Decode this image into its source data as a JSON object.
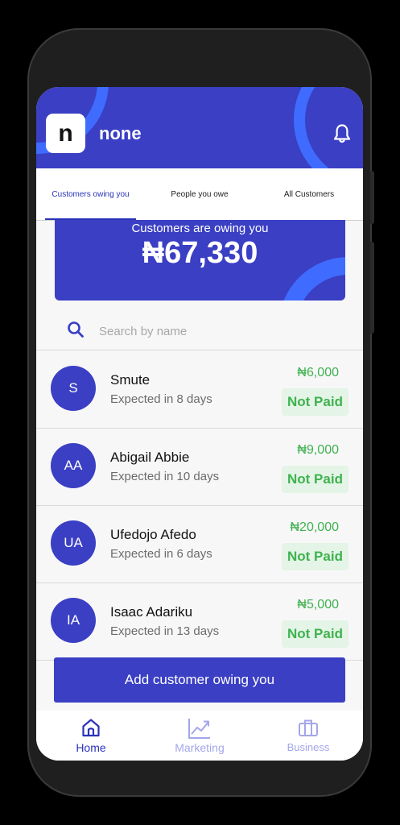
{
  "header": {
    "logo_letter": "n",
    "business_name": "none"
  },
  "tabs": [
    {
      "label": "Customers owing you",
      "active": true
    },
    {
      "label": "People you owe",
      "active": false
    },
    {
      "label": "All Customers",
      "active": false
    }
  ],
  "summary": {
    "label": "Customers are owing you",
    "amount": "₦67,330"
  },
  "search": {
    "placeholder": "Search by name"
  },
  "customers": [
    {
      "initials": "S",
      "name": "Smute",
      "expected": "Expected in 8 days",
      "amount": "₦6,000",
      "status": "Not Paid"
    },
    {
      "initials": "AA",
      "name": "Abigail Abbie",
      "expected": "Expected in 10 days",
      "amount": "₦9,000",
      "status": "Not Paid"
    },
    {
      "initials": "UA",
      "name": "Ufedojo Afedo",
      "expected": "Expected in 6 days",
      "amount": "₦20,000",
      "status": "Not Paid"
    },
    {
      "initials": "IA",
      "name": "Isaac Adariku",
      "expected": "Expected in 13 days",
      "amount": "₦5,000",
      "status": "Not Paid"
    }
  ],
  "cta": {
    "label": "Add customer owing you"
  },
  "bottom_nav": [
    {
      "label": "Home",
      "icon": "home-icon",
      "active": true
    },
    {
      "label": "Marketing",
      "icon": "trending-up-icon",
      "active": false
    },
    {
      "label": "Business",
      "icon": "briefcase-icon",
      "active": false
    }
  ],
  "colors": {
    "primary": "#3a3fc4",
    "accent_arc": "#3f6cff",
    "paid_status": "#3fb24f",
    "status_bg": "#e4f4e6",
    "nav_inactive": "#a3a6ea"
  }
}
